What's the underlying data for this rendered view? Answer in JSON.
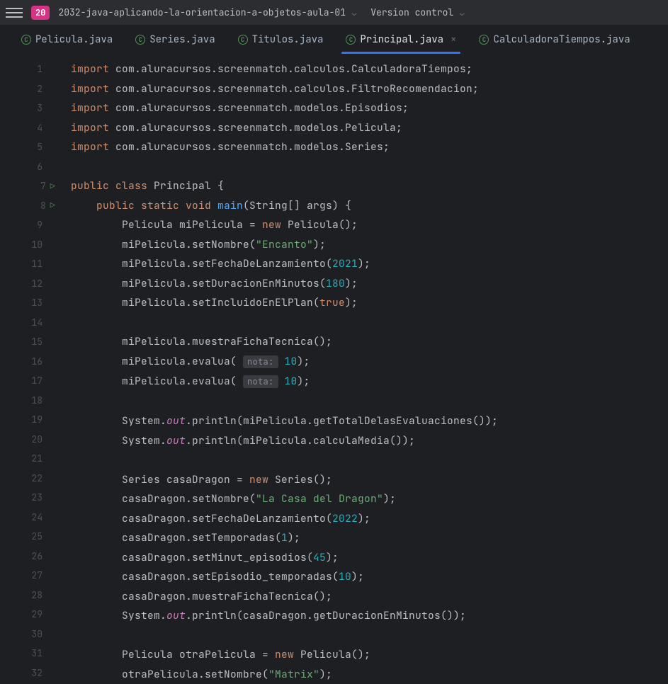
{
  "toolbar": {
    "project_badge": "20",
    "project_name": "2032-java-aplicando-la-orientacion-a-objetos-aula-01",
    "version_control": "Version control"
  },
  "tabs": [
    {
      "label": "Pelicula.java",
      "active": false
    },
    {
      "label": "Series.java",
      "active": false
    },
    {
      "label": "Titulos.java",
      "active": false
    },
    {
      "label": "Principal.java",
      "active": true
    },
    {
      "label": "CalculadoraTiempos.java",
      "active": false
    }
  ],
  "code_lines": [
    {
      "n": 1,
      "tokens": [
        [
          "kw",
          "import "
        ],
        [
          "",
          "com.aluracursos.screenmatch.calculos.CalculadoraTiempos;"
        ]
      ]
    },
    {
      "n": 2,
      "tokens": [
        [
          "kw",
          "import "
        ],
        [
          "",
          "com.aluracursos.screenmatch.calculos.FiltroRecomendacion;"
        ]
      ]
    },
    {
      "n": 3,
      "tokens": [
        [
          "kw",
          "import "
        ],
        [
          "",
          "com.aluracursos.screenmatch.modelos.Episodios;"
        ]
      ]
    },
    {
      "n": 4,
      "tokens": [
        [
          "kw",
          "import "
        ],
        [
          "",
          "com.aluracursos.screenmatch.modelos.Pelicula;"
        ]
      ]
    },
    {
      "n": 5,
      "tokens": [
        [
          "kw",
          "import "
        ],
        [
          "",
          "com.aluracursos.screenmatch.modelos.Series;"
        ]
      ]
    },
    {
      "n": 6,
      "tokens": []
    },
    {
      "n": 7,
      "run": true,
      "tokens": [
        [
          "kw",
          "public class "
        ],
        [
          "",
          "Principal {"
        ]
      ]
    },
    {
      "n": 8,
      "run": true,
      "indent": 1,
      "tokens": [
        [
          "kw",
          "public static void "
        ],
        [
          "fn",
          "main"
        ],
        [
          "",
          "(String[] args) {"
        ]
      ]
    },
    {
      "n": 9,
      "indent": 2,
      "tokens": [
        [
          "",
          "Pelicula miPelicula = "
        ],
        [
          "kw",
          "new "
        ],
        [
          "",
          "Pelicula();"
        ]
      ]
    },
    {
      "n": 10,
      "indent": 2,
      "tokens": [
        [
          "",
          "miPelicula.setNombre("
        ],
        [
          "str",
          "\"Encanto\""
        ],
        [
          "",
          ");"
        ]
      ]
    },
    {
      "n": 11,
      "indent": 2,
      "tokens": [
        [
          "",
          "miPelicula.setFechaDeLanzamiento("
        ],
        [
          "num",
          "2021"
        ],
        [
          "",
          ");"
        ]
      ]
    },
    {
      "n": 12,
      "indent": 2,
      "tokens": [
        [
          "",
          "miPelicula.setDuracionEnMinutos("
        ],
        [
          "num",
          "180"
        ],
        [
          "",
          ");"
        ]
      ]
    },
    {
      "n": 13,
      "indent": 2,
      "tokens": [
        [
          "",
          "miPelicula.setIncluidoEnElPlan("
        ],
        [
          "bool",
          "true"
        ],
        [
          "",
          ");"
        ]
      ]
    },
    {
      "n": 14,
      "indent": 2,
      "tokens": []
    },
    {
      "n": 15,
      "indent": 2,
      "tokens": [
        [
          "",
          "miPelicula.muestraFichaTecnica();"
        ]
      ]
    },
    {
      "n": 16,
      "indent": 2,
      "tokens": [
        [
          "",
          "miPelicula.evalua( "
        ],
        [
          "hint",
          "nota:"
        ],
        [
          "",
          ""
        ],
        [
          "num",
          " 10"
        ],
        [
          "",
          ");"
        ]
      ]
    },
    {
      "n": 17,
      "indent": 2,
      "tokens": [
        [
          "",
          "miPelicula.evalua( "
        ],
        [
          "hint",
          "nota:"
        ],
        [
          "",
          ""
        ],
        [
          "num",
          " 10"
        ],
        [
          "",
          ");"
        ]
      ]
    },
    {
      "n": 18,
      "indent": 2,
      "tokens": []
    },
    {
      "n": 19,
      "indent": 2,
      "tokens": [
        [
          "",
          "System."
        ],
        [
          "field",
          "out"
        ],
        [
          "",
          ".println(miPelicula.getTotalDelasEvaluaciones());"
        ]
      ]
    },
    {
      "n": 20,
      "indent": 2,
      "tokens": [
        [
          "",
          "System."
        ],
        [
          "field",
          "out"
        ],
        [
          "",
          ".println(miPelicula.calculaMedia());"
        ]
      ]
    },
    {
      "n": 21,
      "indent": 2,
      "tokens": []
    },
    {
      "n": 22,
      "indent": 2,
      "tokens": [
        [
          "",
          "Series casaDragon = "
        ],
        [
          "kw",
          "new "
        ],
        [
          "",
          "Series();"
        ]
      ]
    },
    {
      "n": 23,
      "indent": 2,
      "tokens": [
        [
          "",
          "casaDragon.setNombre("
        ],
        [
          "str",
          "\"La Casa del Dragon\""
        ],
        [
          "",
          ");"
        ]
      ]
    },
    {
      "n": 24,
      "indent": 2,
      "tokens": [
        [
          "",
          "casaDragon.setFechaDeLanzamiento("
        ],
        [
          "num",
          "2022"
        ],
        [
          "",
          ");"
        ]
      ]
    },
    {
      "n": 25,
      "indent": 2,
      "tokens": [
        [
          "",
          "casaDragon.setTemporadas("
        ],
        [
          "num",
          "1"
        ],
        [
          "",
          ");"
        ]
      ]
    },
    {
      "n": 26,
      "indent": 2,
      "tokens": [
        [
          "",
          "casaDragon.setMinut_episodios("
        ],
        [
          "num",
          "45"
        ],
        [
          "",
          ");"
        ]
      ]
    },
    {
      "n": 27,
      "indent": 2,
      "tokens": [
        [
          "",
          "casaDragon.setEpisodio_temporadas("
        ],
        [
          "num",
          "10"
        ],
        [
          "",
          ");"
        ]
      ]
    },
    {
      "n": 28,
      "indent": 2,
      "tokens": [
        [
          "",
          "casaDragon.muestraFichaTecnica();"
        ]
      ]
    },
    {
      "n": 29,
      "indent": 2,
      "tokens": [
        [
          "",
          "System."
        ],
        [
          "field",
          "out"
        ],
        [
          "",
          ".println(casaDragon.getDuracionEnMinutos());"
        ]
      ]
    },
    {
      "n": 30,
      "indent": 2,
      "tokens": []
    },
    {
      "n": 31,
      "indent": 2,
      "tokens": [
        [
          "",
          "Pelicula otraPelicula = "
        ],
        [
          "kw",
          "new "
        ],
        [
          "",
          "Pelicula();"
        ]
      ]
    },
    {
      "n": 32,
      "indent": 2,
      "tokens": [
        [
          "",
          "otraPelicula.setNombre("
        ],
        [
          "str",
          "\"Matrix\""
        ],
        [
          "",
          ");"
        ]
      ]
    }
  ]
}
